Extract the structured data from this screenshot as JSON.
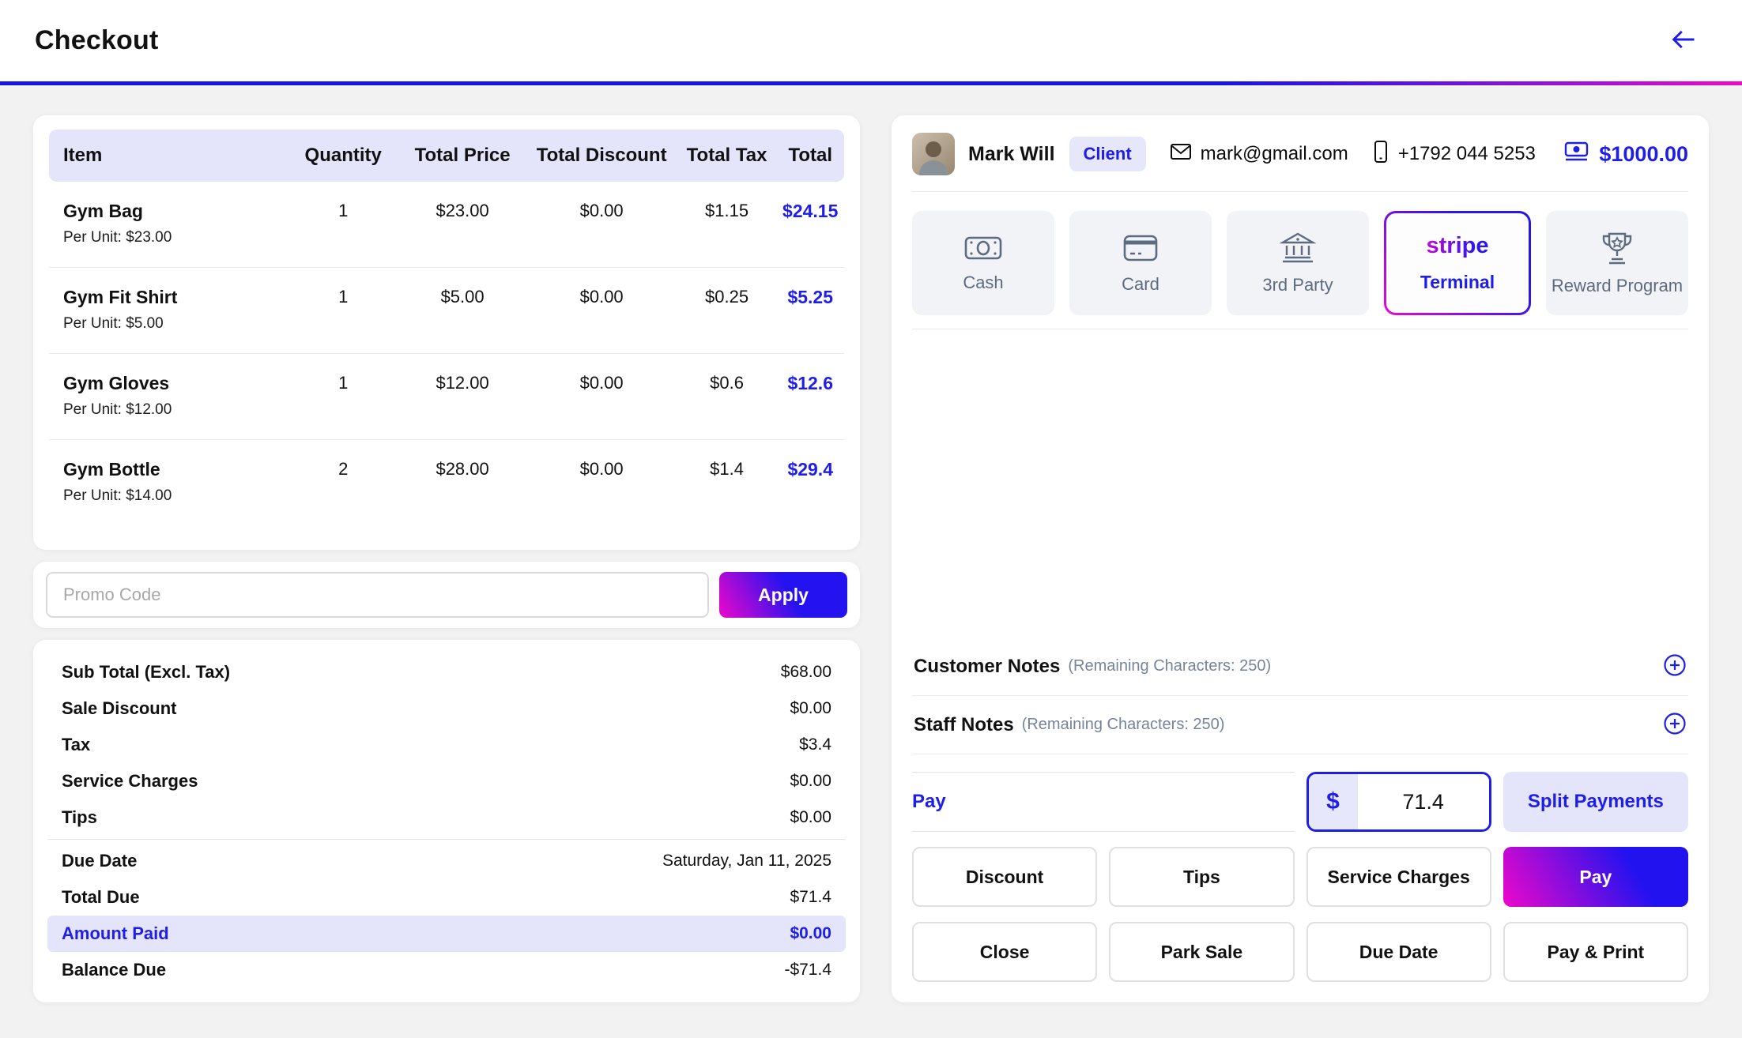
{
  "header": {
    "title": "Checkout"
  },
  "items_table": {
    "columns": [
      "Item",
      "Quantity",
      "Total Price",
      "Total Discount",
      "Total Tax",
      "Total"
    ],
    "rows": [
      {
        "name": "Gym Bag",
        "per_unit": "Per Unit: $23.00",
        "quantity": "1",
        "total_price": "$23.00",
        "total_discount": "$0.00",
        "total_tax": "$1.15",
        "total": "$24.15"
      },
      {
        "name": "Gym Fit Shirt",
        "per_unit": "Per Unit: $5.00",
        "quantity": "1",
        "total_price": "$5.00",
        "total_discount": "$0.00",
        "total_tax": "$0.25",
        "total": "$5.25"
      },
      {
        "name": "Gym Gloves",
        "per_unit": "Per Unit: $12.00",
        "quantity": "1",
        "total_price": "$12.00",
        "total_discount": "$0.00",
        "total_tax": "$0.6",
        "total": "$12.6"
      },
      {
        "name": "Gym Bottle",
        "per_unit": "Per Unit: $14.00",
        "quantity": "2",
        "total_price": "$28.00",
        "total_discount": "$0.00",
        "total_tax": "$1.4",
        "total": "$29.4"
      }
    ]
  },
  "promo": {
    "placeholder": "Promo Code",
    "apply_label": "Apply"
  },
  "summary": {
    "rows": [
      {
        "label": "Sub Total (Excl. Tax)",
        "value": "$68.00"
      },
      {
        "label": "Sale Discount",
        "value": "$0.00"
      },
      {
        "label": "Tax",
        "value": "$3.4"
      },
      {
        "label": "Service Charges",
        "value": "$0.00"
      },
      {
        "label": "Tips",
        "value": "$0.00"
      },
      {
        "label": "Due Date",
        "value": "Saturday, Jan 11, 2025"
      },
      {
        "label": "Total Due",
        "value": "$71.4"
      },
      {
        "label": "Amount Paid",
        "value": "$0.00"
      },
      {
        "label": "Balance Due",
        "value": "-$71.4"
      }
    ]
  },
  "customer": {
    "name": "Mark Will",
    "badge": "Client",
    "email": "mark@gmail.com",
    "phone": "+1792 044 5253",
    "balance": "$1000.00"
  },
  "payment_methods": [
    {
      "label": "Cash"
    },
    {
      "label": "Card"
    },
    {
      "label": "3rd Party"
    },
    {
      "brand": "stripe",
      "label": "Terminal",
      "selected": true
    },
    {
      "label": "Reward Program"
    }
  ],
  "notes": {
    "customer": {
      "label": "Customer Notes",
      "hint": "(Remaining Characters: 250)"
    },
    "staff": {
      "label": "Staff Notes",
      "hint": "(Remaining Characters: 250)"
    }
  },
  "pay_section": {
    "label": "Pay",
    "currency": "$",
    "amount": "71.4",
    "split_label": "Split Payments"
  },
  "actions": {
    "row1": [
      "Discount",
      "Tips",
      "Service Charges",
      "Pay"
    ],
    "row2": [
      "Close",
      "Park Sale",
      "Due Date",
      "Pay & Print"
    ]
  },
  "colors": {
    "accent_blue": "#1e1ee8",
    "magenta": "#e90bd1",
    "lavender": "#e7e7fb",
    "icon_gray": "#5d6b81"
  }
}
